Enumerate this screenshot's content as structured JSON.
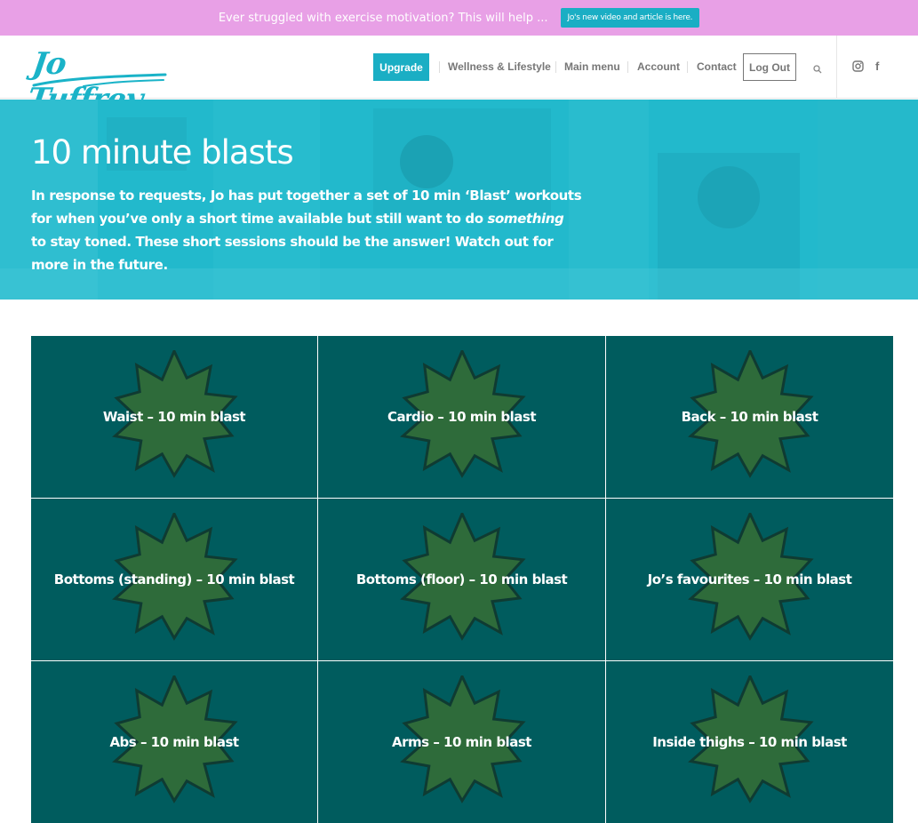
{
  "promo": {
    "text": "Ever struggled with exercise motivation? This will help ...",
    "button": "Jo's new video and article is here."
  },
  "brand": {
    "logo_text": "Jo Tuffrey",
    "accent": "#1aaec4",
    "promo_color": "#e8a0e6",
    "tile_color": "#005c5e",
    "burst_color": "#2e6b3a"
  },
  "nav": {
    "upgrade": "Upgrade",
    "wellness": "Wellness & Lifestyle",
    "main_menu": "Main menu",
    "account": "Account",
    "contact": "Contact",
    "logout": "Log Out",
    "search_icon": "search-icon",
    "instagram_icon": "instagram-icon",
    "facebook_icon": "facebook-icon",
    "facebook_glyph": "f"
  },
  "hero": {
    "title": "10 minute blasts",
    "desc_part1": "In response to requests, Jo has put together a set of 10 min ‘Blast’ workouts for when you’ve only a short time available but still want to do ",
    "desc_em": "something",
    "desc_part2": " to stay toned. These short sessions should be the answer! Watch out for more in the future."
  },
  "tiles": [
    {
      "label": "Waist – 10 min blast"
    },
    {
      "label": "Cardio – 10 min blast"
    },
    {
      "label": "Back – 10 min blast"
    },
    {
      "label": "Bottoms (standing) – 10 min blast"
    },
    {
      "label": "Bottoms (floor) – 10 min blast"
    },
    {
      "label": "Jo’s favourites – 10 min blast"
    },
    {
      "label": "Abs – 10 min blast"
    },
    {
      "label": "Arms – 10 min blast"
    },
    {
      "label": "Inside thighs – 10 min blast"
    }
  ]
}
